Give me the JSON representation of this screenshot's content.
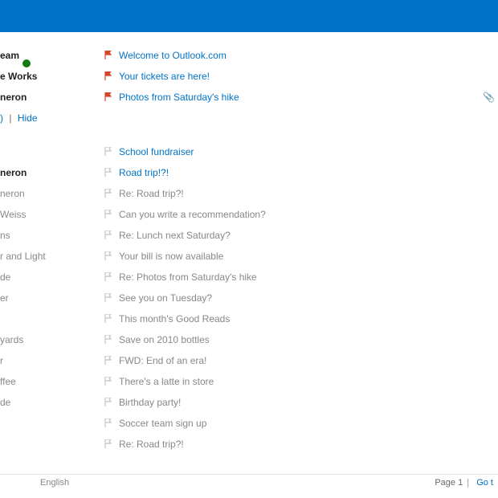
{
  "actions": {
    "hide": "Hide"
  },
  "footer": {
    "language": "English",
    "page_label": "Page 1",
    "go_label": "Go t"
  },
  "top": [
    {
      "sender": "eam",
      "status": "green",
      "subject": "Welcome to Outlook.com",
      "flag": "red",
      "unread": true
    },
    {
      "sender": "e Works",
      "status": "",
      "subject": "Your tickets are here!",
      "flag": "red",
      "unread": true
    },
    {
      "sender": "neron",
      "status": "",
      "subject": "Photos from Saturday's hike",
      "flag": "red",
      "unread": true,
      "attach": true
    }
  ],
  "list": [
    {
      "sender": "",
      "subject": "School fundraiser",
      "flag": "grey",
      "linked": true
    },
    {
      "sender": "neron",
      "subject": "Road trip!?!",
      "flag": "grey",
      "linked": true,
      "bold": true
    },
    {
      "sender": "neron",
      "subject": "Re: Road trip?!",
      "flag": "grey"
    },
    {
      "sender": "Weiss",
      "subject": "Can you write a recommendation?",
      "flag": "grey"
    },
    {
      "sender": "ns",
      "subject": "Re: Lunch next Saturday?",
      "flag": "grey"
    },
    {
      "sender": "r and Light",
      "subject": "Your bill is now available",
      "flag": "grey"
    },
    {
      "sender": "de",
      "subject": "Re: Photos from Saturday's hike",
      "flag": "grey"
    },
    {
      "sender": "er",
      "subject": "See you on Tuesday?",
      "flag": "grey"
    },
    {
      "sender": "",
      "subject": "This month's Good Reads",
      "flag": "grey"
    },
    {
      "sender": "yards",
      "subject": "Save on 2010 bottles",
      "flag": "grey"
    },
    {
      "sender": "r",
      "subject": "FWD: End of an era!",
      "flag": "grey"
    },
    {
      "sender": "ffee",
      "subject": "There's a latte in store",
      "flag": "grey"
    },
    {
      "sender": "de",
      "subject": "Birthday party!",
      "flag": "grey"
    },
    {
      "sender": "",
      "subject": "Soccer team sign up",
      "flag": "grey"
    },
    {
      "sender": "",
      "subject": "Re: Road trip?!",
      "flag": "grey"
    }
  ]
}
